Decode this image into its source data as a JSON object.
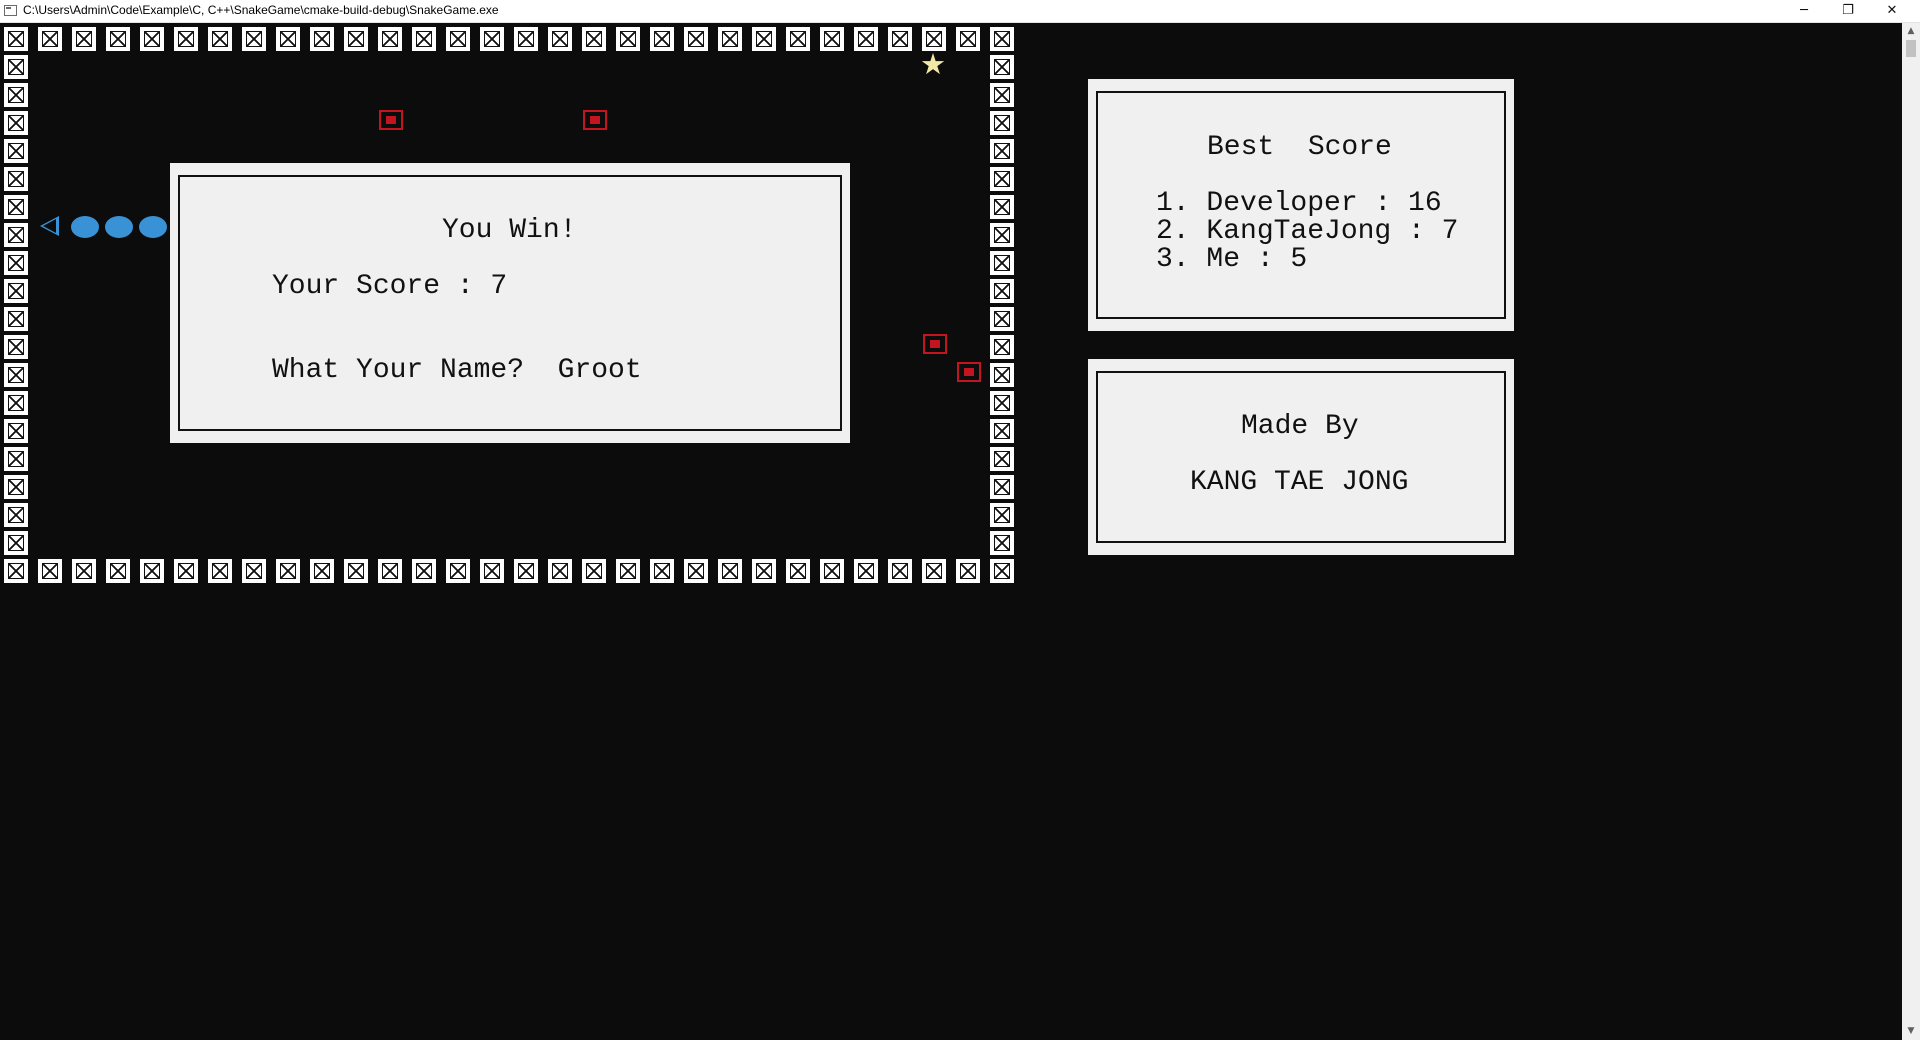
{
  "window": {
    "title": "C:\\Users\\Admin\\Code\\Example\\C, C++\\SnakeGame\\cmake-build-debug\\SnakeGame.exe",
    "min_glyph": "─",
    "max_glyph": "❐",
    "close_glyph": "✕"
  },
  "scrollbar": {
    "up_glyph": "▲",
    "down_glyph": "▼"
  },
  "game": {
    "star_glyph": "★",
    "colors": {
      "background": "#0c0c0c",
      "snake": "#3a92d6",
      "item": "#c2151f",
      "star": "#f3e7a6",
      "panel": "#f0f0f0"
    }
  },
  "win_dialog": {
    "title": "You Win!",
    "score_line": "Your Score : 7",
    "name_line": "What Your Name?  Groot"
  },
  "best_score": {
    "title": "Best  Score",
    "entries": [
      "1. Developer : 16",
      "2. KangTaeJong : 7",
      "3. Me : 5"
    ]
  },
  "credits": {
    "title": "Made By",
    "author": "KANG TAE JONG"
  }
}
